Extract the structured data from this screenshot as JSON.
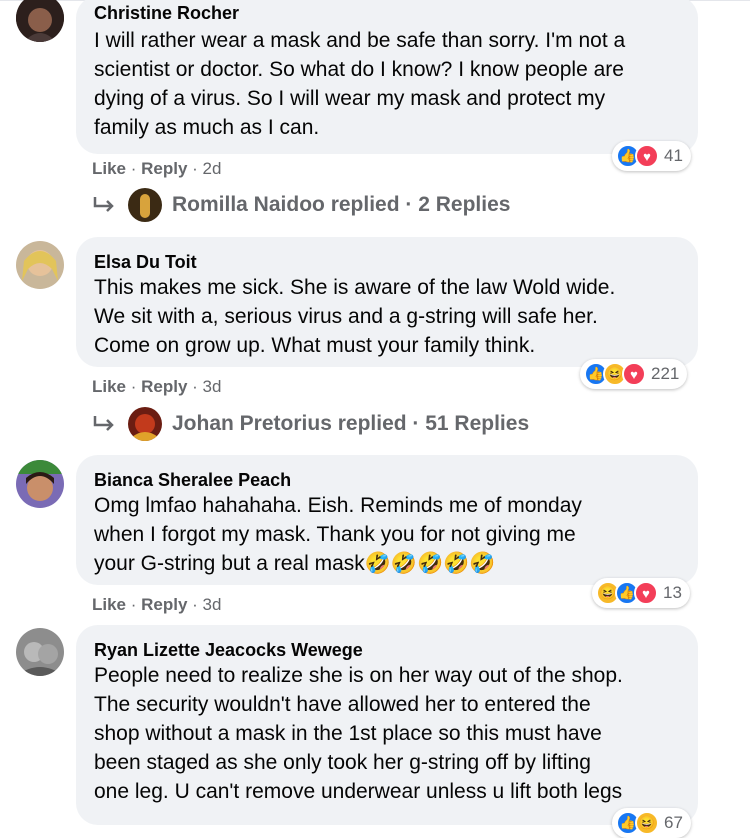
{
  "comments": [
    {
      "author": "Christine Rocher",
      "text": "I will rather wear a mask and be safe than sorry. I'm not a\nscientist or doctor. So what do I know? I know people are\ndying of a virus. So I will wear my mask and protect my\nfamily as much as I can.",
      "like": "Like",
      "reply": "Reply",
      "time": "2d",
      "reaction_count": "41",
      "reactions": [
        "like-icon",
        "love-icon"
      ],
      "replies": {
        "name": "Romilla Naidoo",
        "label": "replied · 2 Replies"
      }
    },
    {
      "author": "Elsa Du Toit",
      "text": "This makes me sick. She is aware of the law Wold wide.\nWe sit with a, serious virus and a g-string will safe her.\nCome on grow up. What must your family think.",
      "like": "Like",
      "reply": "Reply",
      "time": "3d",
      "reaction_count": "221",
      "reactions": [
        "like-icon",
        "haha-icon",
        "love-icon"
      ],
      "replies": {
        "name": "Johan Pretorius",
        "label": "replied · 51 Replies"
      }
    },
    {
      "author": "Bianca Sheralee Peach",
      "text": "Omg lmfao hahahaha. Eish. Reminds me of monday\nwhen I forgot my mask. Thank you for not giving me\nyour G-string but a real mask",
      "emoji": "🤣🤣🤣🤣🤣",
      "like": "Like",
      "reply": "Reply",
      "time": "3d",
      "reaction_count": "13",
      "reactions": [
        "haha-icon",
        "like-icon",
        "love-icon"
      ]
    },
    {
      "author": "Ryan Lizette Jeacocks Wewege",
      "text": "People need to realize she is on her way out of the shop.\nThe security wouldn't have allowed her to entered the\nshop without a mask in the 1st place so this must have\nbeen staged as she only took her g-string off by lifting\none leg. U can't remove underwear unless u lift both legs",
      "reaction_count": "67"
    }
  ],
  "colors": {
    "like": "#1877f2",
    "love": "#f33e58",
    "haha": "#f7b928",
    "bubble": "#f0f2f5",
    "meta": "#65676b"
  }
}
